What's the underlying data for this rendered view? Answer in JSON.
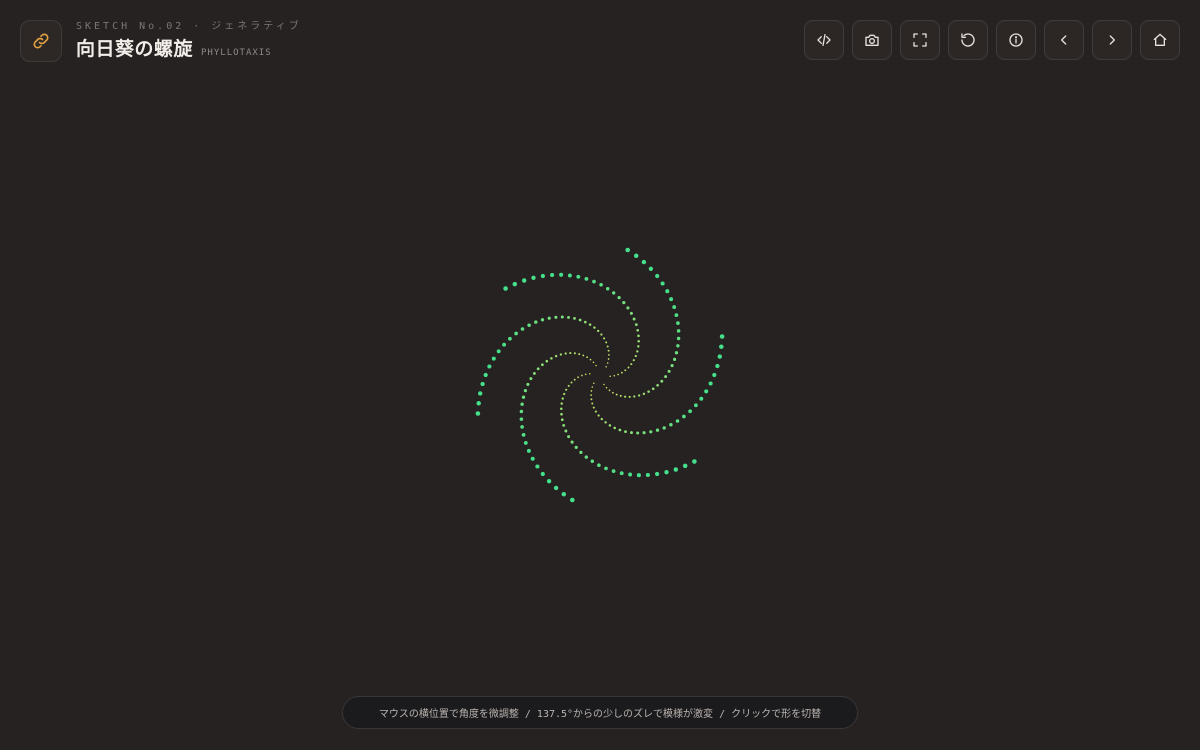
{
  "header": {
    "kicker": "SKETCH No.02 · ジェネラティブ",
    "title": "向日葵の螺旋",
    "subtitle": "PHYLLOTAXIS"
  },
  "toolbar": {
    "buttons": [
      {
        "name": "view-source-button",
        "icon": "code-icon"
      },
      {
        "name": "screenshot-button",
        "icon": "camera-icon"
      },
      {
        "name": "fullscreen-button",
        "icon": "fullscreen-icon"
      },
      {
        "name": "reset-button",
        "icon": "refresh-icon"
      },
      {
        "name": "info-button",
        "icon": "info-icon"
      },
      {
        "name": "prev-sketch-button",
        "icon": "chevron-left-icon"
      },
      {
        "name": "next-sketch-button",
        "icon": "chevron-right-icon"
      },
      {
        "name": "home-button",
        "icon": "home-icon"
      }
    ]
  },
  "logo": {
    "icon": "link-icon",
    "color": "#e0a040"
  },
  "hint": {
    "text": "マウスの横位置で角度を微調整 / 137.5°からの少しのズレで模様が激変 / クリックで形を切替"
  },
  "colors": {
    "background": "#262221",
    "dot_inner": "#d8e060",
    "dot_outer": "#45e08a"
  }
}
